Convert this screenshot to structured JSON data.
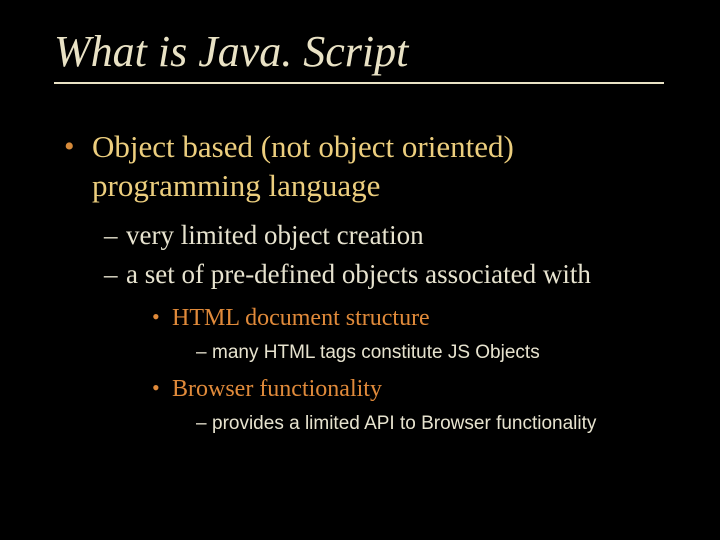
{
  "title": "What is Java. Script",
  "bullets": {
    "lvl1_0": "Object based (not object oriented) programming language",
    "lvl2_0": "very limited object creation",
    "lvl2_1": "a set of pre-defined objects associated with",
    "lvl3_0": "HTML document structure",
    "lvl4_0": "many HTML tags constitute JS Objects",
    "lvl3_1": "Browser functionality",
    "lvl4_1": "provides a limited API to Browser functionality"
  }
}
